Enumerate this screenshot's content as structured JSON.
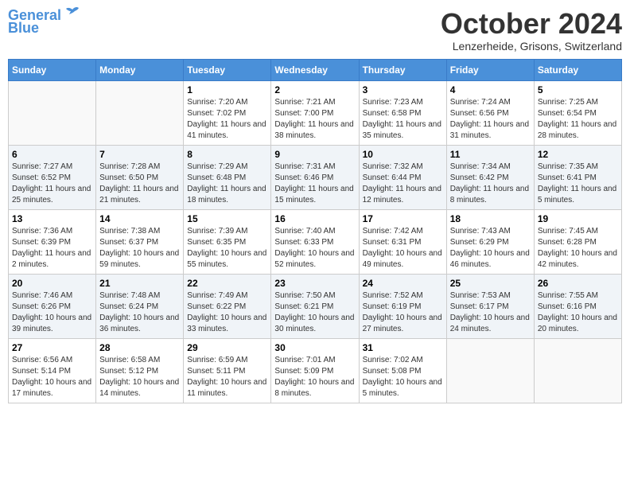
{
  "header": {
    "logo_line1": "General",
    "logo_line2": "Blue",
    "month": "October 2024",
    "location": "Lenzerheide, Grisons, Switzerland"
  },
  "weekdays": [
    "Sunday",
    "Monday",
    "Tuesday",
    "Wednesday",
    "Thursday",
    "Friday",
    "Saturday"
  ],
  "weeks": [
    [
      {
        "day": "",
        "sunrise": "",
        "sunset": "",
        "daylight": ""
      },
      {
        "day": "",
        "sunrise": "",
        "sunset": "",
        "daylight": ""
      },
      {
        "day": "1",
        "sunrise": "Sunrise: 7:20 AM",
        "sunset": "Sunset: 7:02 PM",
        "daylight": "Daylight: 11 hours and 41 minutes."
      },
      {
        "day": "2",
        "sunrise": "Sunrise: 7:21 AM",
        "sunset": "Sunset: 7:00 PM",
        "daylight": "Daylight: 11 hours and 38 minutes."
      },
      {
        "day": "3",
        "sunrise": "Sunrise: 7:23 AM",
        "sunset": "Sunset: 6:58 PM",
        "daylight": "Daylight: 11 hours and 35 minutes."
      },
      {
        "day": "4",
        "sunrise": "Sunrise: 7:24 AM",
        "sunset": "Sunset: 6:56 PM",
        "daylight": "Daylight: 11 hours and 31 minutes."
      },
      {
        "day": "5",
        "sunrise": "Sunrise: 7:25 AM",
        "sunset": "Sunset: 6:54 PM",
        "daylight": "Daylight: 11 hours and 28 minutes."
      }
    ],
    [
      {
        "day": "6",
        "sunrise": "Sunrise: 7:27 AM",
        "sunset": "Sunset: 6:52 PM",
        "daylight": "Daylight: 11 hours and 25 minutes."
      },
      {
        "day": "7",
        "sunrise": "Sunrise: 7:28 AM",
        "sunset": "Sunset: 6:50 PM",
        "daylight": "Daylight: 11 hours and 21 minutes."
      },
      {
        "day": "8",
        "sunrise": "Sunrise: 7:29 AM",
        "sunset": "Sunset: 6:48 PM",
        "daylight": "Daylight: 11 hours and 18 minutes."
      },
      {
        "day": "9",
        "sunrise": "Sunrise: 7:31 AM",
        "sunset": "Sunset: 6:46 PM",
        "daylight": "Daylight: 11 hours and 15 minutes."
      },
      {
        "day": "10",
        "sunrise": "Sunrise: 7:32 AM",
        "sunset": "Sunset: 6:44 PM",
        "daylight": "Daylight: 11 hours and 12 minutes."
      },
      {
        "day": "11",
        "sunrise": "Sunrise: 7:34 AM",
        "sunset": "Sunset: 6:42 PM",
        "daylight": "Daylight: 11 hours and 8 minutes."
      },
      {
        "day": "12",
        "sunrise": "Sunrise: 7:35 AM",
        "sunset": "Sunset: 6:41 PM",
        "daylight": "Daylight: 11 hours and 5 minutes."
      }
    ],
    [
      {
        "day": "13",
        "sunrise": "Sunrise: 7:36 AM",
        "sunset": "Sunset: 6:39 PM",
        "daylight": "Daylight: 11 hours and 2 minutes."
      },
      {
        "day": "14",
        "sunrise": "Sunrise: 7:38 AM",
        "sunset": "Sunset: 6:37 PM",
        "daylight": "Daylight: 10 hours and 59 minutes."
      },
      {
        "day": "15",
        "sunrise": "Sunrise: 7:39 AM",
        "sunset": "Sunset: 6:35 PM",
        "daylight": "Daylight: 10 hours and 55 minutes."
      },
      {
        "day": "16",
        "sunrise": "Sunrise: 7:40 AM",
        "sunset": "Sunset: 6:33 PM",
        "daylight": "Daylight: 10 hours and 52 minutes."
      },
      {
        "day": "17",
        "sunrise": "Sunrise: 7:42 AM",
        "sunset": "Sunset: 6:31 PM",
        "daylight": "Daylight: 10 hours and 49 minutes."
      },
      {
        "day": "18",
        "sunrise": "Sunrise: 7:43 AM",
        "sunset": "Sunset: 6:29 PM",
        "daylight": "Daylight: 10 hours and 46 minutes."
      },
      {
        "day": "19",
        "sunrise": "Sunrise: 7:45 AM",
        "sunset": "Sunset: 6:28 PM",
        "daylight": "Daylight: 10 hours and 42 minutes."
      }
    ],
    [
      {
        "day": "20",
        "sunrise": "Sunrise: 7:46 AM",
        "sunset": "Sunset: 6:26 PM",
        "daylight": "Daylight: 10 hours and 39 minutes."
      },
      {
        "day": "21",
        "sunrise": "Sunrise: 7:48 AM",
        "sunset": "Sunset: 6:24 PM",
        "daylight": "Daylight: 10 hours and 36 minutes."
      },
      {
        "day": "22",
        "sunrise": "Sunrise: 7:49 AM",
        "sunset": "Sunset: 6:22 PM",
        "daylight": "Daylight: 10 hours and 33 minutes."
      },
      {
        "day": "23",
        "sunrise": "Sunrise: 7:50 AM",
        "sunset": "Sunset: 6:21 PM",
        "daylight": "Daylight: 10 hours and 30 minutes."
      },
      {
        "day": "24",
        "sunrise": "Sunrise: 7:52 AM",
        "sunset": "Sunset: 6:19 PM",
        "daylight": "Daylight: 10 hours and 27 minutes."
      },
      {
        "day": "25",
        "sunrise": "Sunrise: 7:53 AM",
        "sunset": "Sunset: 6:17 PM",
        "daylight": "Daylight: 10 hours and 24 minutes."
      },
      {
        "day": "26",
        "sunrise": "Sunrise: 7:55 AM",
        "sunset": "Sunset: 6:16 PM",
        "daylight": "Daylight: 10 hours and 20 minutes."
      }
    ],
    [
      {
        "day": "27",
        "sunrise": "Sunrise: 6:56 AM",
        "sunset": "Sunset: 5:14 PM",
        "daylight": "Daylight: 10 hours and 17 minutes."
      },
      {
        "day": "28",
        "sunrise": "Sunrise: 6:58 AM",
        "sunset": "Sunset: 5:12 PM",
        "daylight": "Daylight: 10 hours and 14 minutes."
      },
      {
        "day": "29",
        "sunrise": "Sunrise: 6:59 AM",
        "sunset": "Sunset: 5:11 PM",
        "daylight": "Daylight: 10 hours and 11 minutes."
      },
      {
        "day": "30",
        "sunrise": "Sunrise: 7:01 AM",
        "sunset": "Sunset: 5:09 PM",
        "daylight": "Daylight: 10 hours and 8 minutes."
      },
      {
        "day": "31",
        "sunrise": "Sunrise: 7:02 AM",
        "sunset": "Sunset: 5:08 PM",
        "daylight": "Daylight: 10 hours and 5 minutes."
      },
      {
        "day": "",
        "sunrise": "",
        "sunset": "",
        "daylight": ""
      },
      {
        "day": "",
        "sunrise": "",
        "sunset": "",
        "daylight": ""
      }
    ]
  ]
}
